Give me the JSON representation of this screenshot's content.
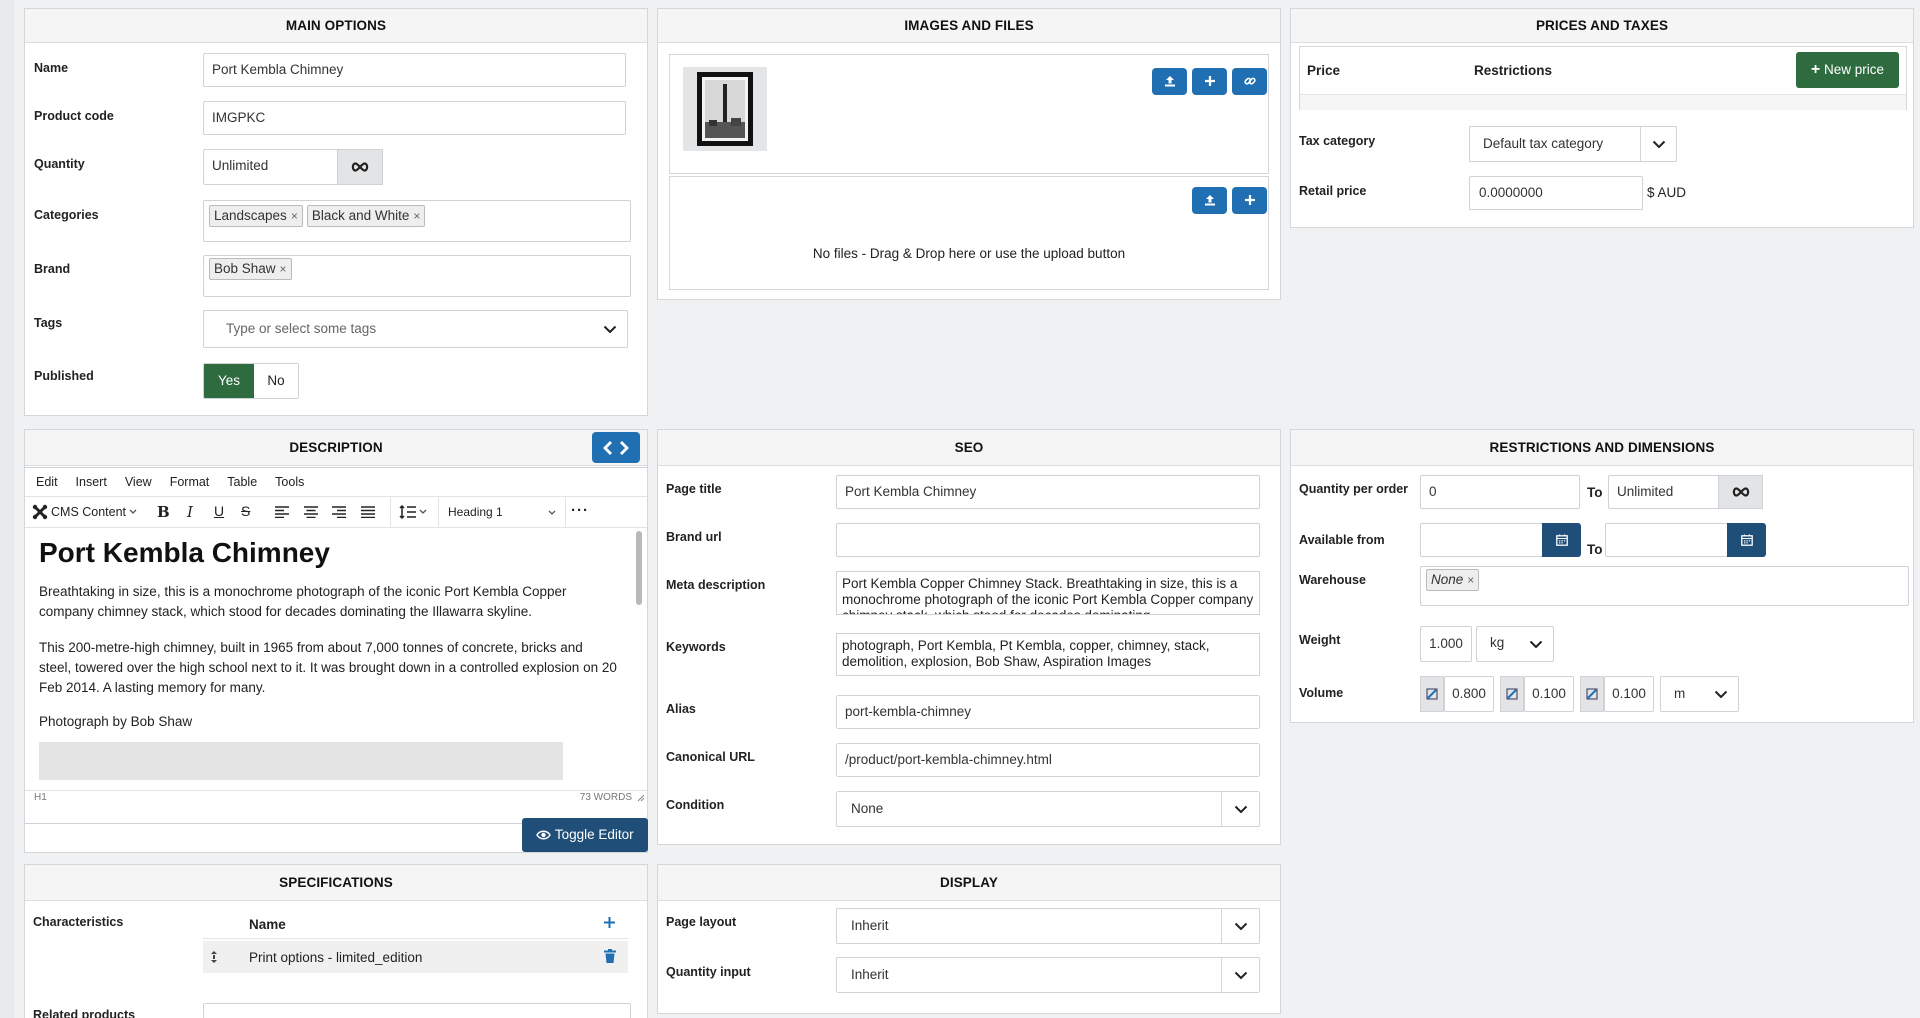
{
  "main_options": {
    "title": "MAIN OPTIONS",
    "name_label": "Name",
    "name_value": "Port Kembla Chimney",
    "code_label": "Product code",
    "code_value": "IMGPKC",
    "qty_label": "Quantity",
    "qty_value": "Unlimited",
    "categories_label": "Categories",
    "categories": [
      "Landscapes",
      "Black and White"
    ],
    "brand_label": "Brand",
    "brand": "Bob Shaw",
    "tags_label": "Tags",
    "tags_placeholder": "Type or select some tags",
    "published_label": "Published",
    "yes": "Yes",
    "no": "No"
  },
  "images": {
    "title": "IMAGES AND FILES",
    "no_files": "No files - Drag & Drop here or use the upload button"
  },
  "prices": {
    "title": "PRICES AND TAXES",
    "price_col": "Price",
    "restrictions_col": "Restrictions",
    "new_price": "New price",
    "tax_label": "Tax category",
    "tax_value": "Default tax category",
    "retail_label": "Retail price",
    "retail_value": "0.0000000",
    "currency": "$ AUD"
  },
  "description": {
    "title": "DESCRIPTION",
    "menu": [
      "Edit",
      "Insert",
      "View",
      "Format",
      "Table",
      "Tools"
    ],
    "cms_content": "CMS Content",
    "block_format": "Heading 1",
    "heading": "Port Kembla Chimney",
    "p1": "Breathtaking in size, this is a monochrome photograph of the iconic Port Kembla Copper company chimney stack, which stood for decades dominating the Illawarra skyline.",
    "p2": "This 200-metre-high chimney, built in 1965 from about 7,000 tonnes of concrete, bricks and steel, towered over the high school next to it. It was brought down in a controlled explosion on 20 Feb 2014. A lasting memory for many.",
    "p3": "Photograph by Bob Shaw",
    "status_path": "H1",
    "word_count": "73 WORDS",
    "toggle": "Toggle Editor"
  },
  "seo": {
    "title": "SEO",
    "page_title_label": "Page title",
    "page_title_value": "Port Kembla Chimney",
    "brand_url_label": "Brand url",
    "brand_url_value": "",
    "meta_label": "Meta description",
    "meta_value": "Port Kembla Copper Chimney Stack. Breathtaking in size, this is a monochrome photograph of the iconic Port Kembla Copper company chimney stack, which stood for decades dominating",
    "keywords_label": "Keywords",
    "keywords_value": "photograph, Port Kembla, Pt Kembla, copper, chimney, stack, demolition, explosion, Bob Shaw, Aspiration Images",
    "alias_label": "Alias",
    "alias_value": "port-kembla-chimney",
    "canonical_label": "Canonical URL",
    "canonical_value": "/product/port-kembla-chimney.html",
    "condition_label": "Condition",
    "condition_value": "None"
  },
  "restrictions": {
    "title": "RESTRICTIONS AND DIMENSIONS",
    "qpo_label": "Quantity per order",
    "qpo_min": "0",
    "to": "To",
    "qpo_max": "Unlimited",
    "avail_label": "Available from",
    "to2": "To",
    "warehouse_label": "Warehouse",
    "warehouse_value": "None",
    "weight_label": "Weight",
    "weight_value": "1.000",
    "weight_unit": "kg",
    "volume_label": "Volume",
    "vol_x": "0.800",
    "vol_y": "0.100",
    "vol_z": "0.100",
    "vol_unit": "m"
  },
  "specifications": {
    "title": "SPECIFICATIONS",
    "char_label": "Characteristics",
    "name_col": "Name",
    "row1": "Print options - limited_edition",
    "related_label": "Related products"
  },
  "display": {
    "title": "DISPLAY",
    "layout_label": "Page layout",
    "layout_value": "Inherit",
    "qty_input_label": "Quantity input",
    "qty_input_value": "Inherit"
  },
  "colors": {
    "accent": "#1f6fb2",
    "green": "#2e6b3f"
  }
}
